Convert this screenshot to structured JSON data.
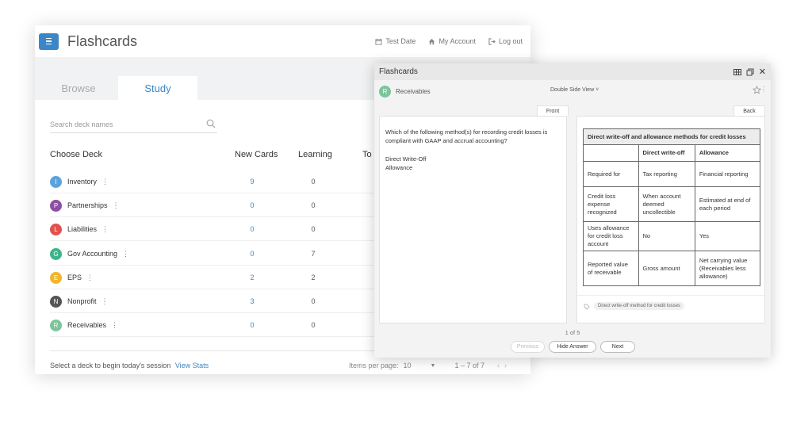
{
  "app": {
    "title": "Flashcards",
    "header_links": [
      {
        "label": "Test Date",
        "icon": "calendar-icon"
      },
      {
        "label": "My Account",
        "icon": "home-icon"
      },
      {
        "label": "Log out",
        "icon": "logout-icon"
      }
    ],
    "tabs": [
      {
        "label": "Browse",
        "active": false
      },
      {
        "label": "Study",
        "active": true
      }
    ],
    "search_placeholder": "Search deck names",
    "columns": {
      "deck": "Choose Deck",
      "new": "New Cards",
      "learning": "Learning",
      "to": "To"
    },
    "decks": [
      {
        "initial": "I",
        "name": "Inventory",
        "new": "9",
        "learning": "0",
        "color": "#5aa3dc"
      },
      {
        "initial": "P",
        "name": "Partnerships",
        "new": "0",
        "learning": "0",
        "color": "#8e4fa2"
      },
      {
        "initial": "L",
        "name": "Liabilities",
        "new": "0",
        "learning": "0",
        "color": "#e2514c"
      },
      {
        "initial": "G",
        "name": "Gov Accounting",
        "new": "0",
        "learning": "7",
        "color": "#3eb489"
      },
      {
        "initial": "E",
        "name": "EPS",
        "new": "2",
        "learning": "2",
        "color": "#f2b52b"
      },
      {
        "initial": "N",
        "name": "Nonprofit",
        "new": "3",
        "learning": "0",
        "color": "#555555"
      },
      {
        "initial": "R",
        "name": "Receivables",
        "new": "0",
        "learning": "0",
        "color": "#7cc49a"
      }
    ],
    "more_glyph": "⋮",
    "footer_text": "Select a deck to begin today's session",
    "footer_link": "View Stats",
    "items_per_page_label": "Items per page:",
    "items_per_page": "10",
    "range": "1 – 7 of 7"
  },
  "flashcard": {
    "title": "Flashcards",
    "deck_initial": "R",
    "deck_name": "Receivables",
    "view_mode": "Double Side View ˅",
    "front_label": "Front",
    "back_label": "Back",
    "question": "Which of the following method(s) for recording credit losses is compliant with GAAP and accrual accounting?",
    "answer_lines": [
      "Direct Write-Off",
      "Allowance"
    ],
    "table": {
      "caption": "Direct write-off and allowance methods for credit losses",
      "headers": [
        "",
        "Direct write-off",
        "Allowance"
      ],
      "rows": [
        [
          "Required for",
          "Tax reporting",
          "Financial reporting"
        ],
        [
          "Credit loss expense recognized",
          "When account deemed uncollectible",
          "Estimated at end of each period"
        ],
        [
          "Uses allowance for credit loss account",
          "No",
          "Yes"
        ],
        [
          "Reported value of receivable",
          "Gross amount",
          "Net carrying value (Receivables less allowance)"
        ]
      ]
    },
    "tag": "Direct write-off method for credit losses",
    "counter": "1 of 5",
    "buttons": {
      "previous": "Previous",
      "hide": "Hide Answer",
      "next": "Next"
    }
  }
}
